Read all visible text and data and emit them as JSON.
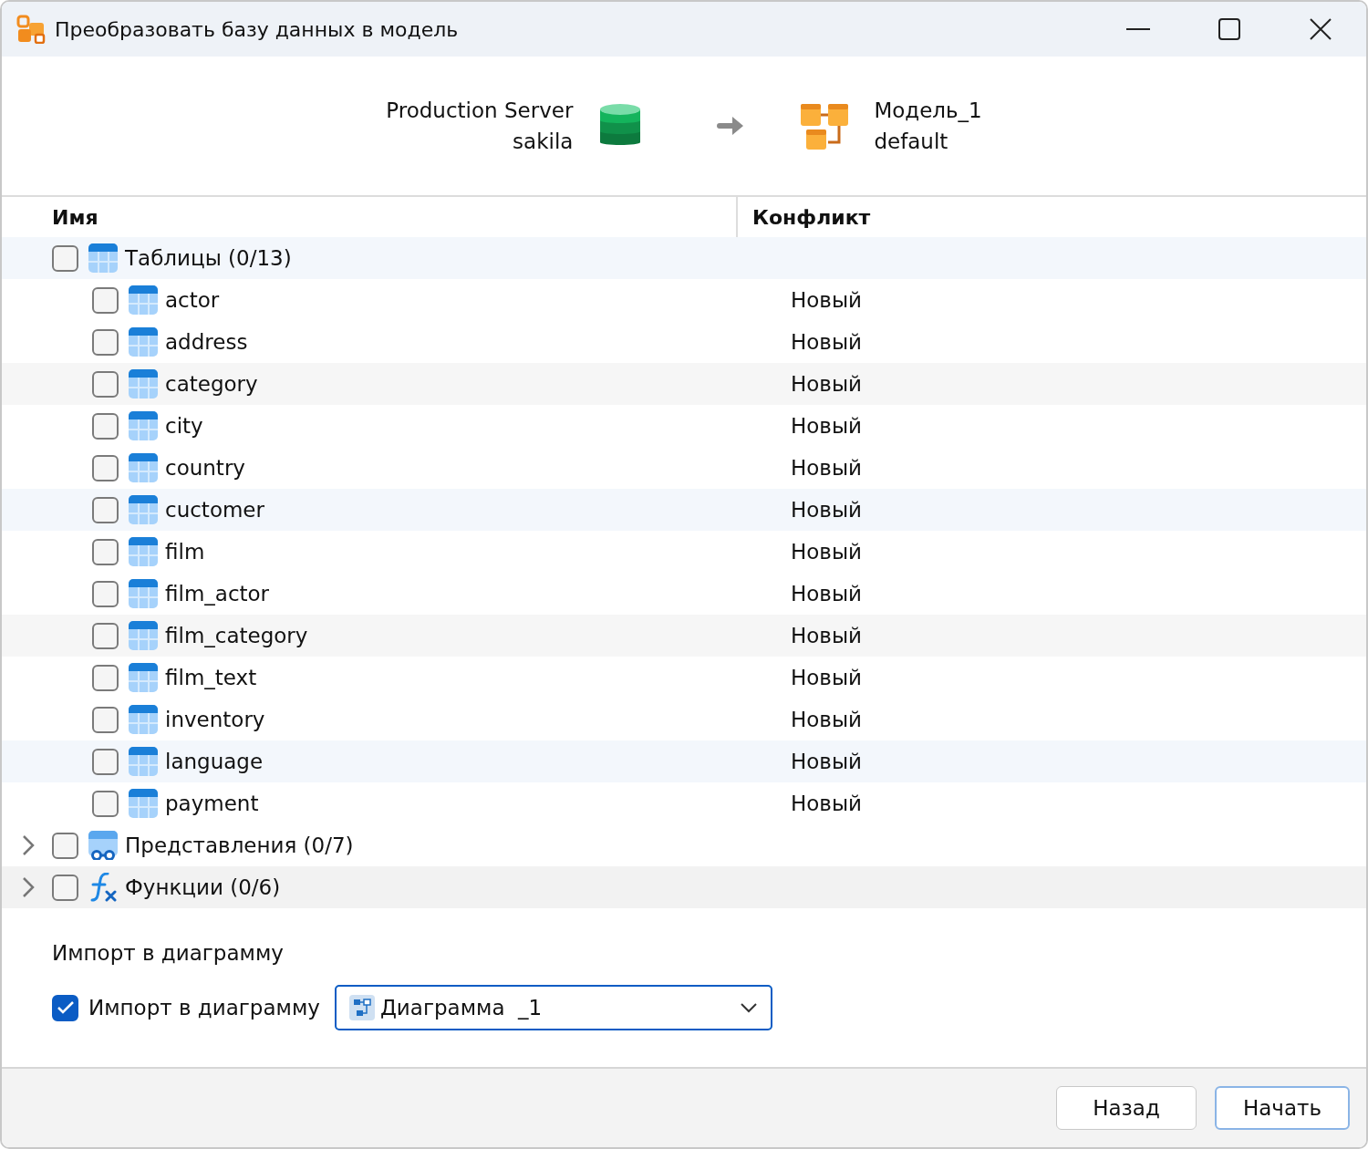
{
  "window": {
    "title": "Преобразовать базу данных в модель"
  },
  "source": {
    "name": "Production Server",
    "database": "sakila"
  },
  "target": {
    "name": "Модель_1",
    "schema": "default"
  },
  "table": {
    "columns": [
      "Имя",
      "Конфликт"
    ],
    "groups": [
      {
        "kind": "tables",
        "label": "Таблицы (0/13)",
        "checked": false,
        "expanded": true,
        "highlighted": true,
        "color": "#f3f7fc",
        "children": [
          {
            "label": "actor",
            "checked": false,
            "conflict": "Новый",
            "highlighted": false
          },
          {
            "label": "address",
            "checked": false,
            "conflict": "Новый",
            "highlighted": false
          },
          {
            "label": "category",
            "checked": false,
            "conflict": "Новый",
            "highlighted": true,
            "color": "#f6f6f6"
          },
          {
            "label": "city",
            "checked": false,
            "conflict": "Новый",
            "highlighted": false
          },
          {
            "label": "country",
            "checked": false,
            "conflict": "Новый",
            "highlighted": false
          },
          {
            "label": "cuctomer",
            "checked": false,
            "conflict": "Новый",
            "highlighted": true,
            "color": "#f3f7fc"
          },
          {
            "label": "film",
            "checked": false,
            "conflict": "Новый",
            "highlighted": false
          },
          {
            "label": "film_actor",
            "checked": false,
            "conflict": "Новый",
            "highlighted": false
          },
          {
            "label": "film_category",
            "checked": false,
            "conflict": "Новый",
            "highlighted": true,
            "color": "#f6f6f6"
          },
          {
            "label": "film_text",
            "checked": false,
            "conflict": "Новый",
            "highlighted": false
          },
          {
            "label": "inventory",
            "checked": false,
            "conflict": "Новый",
            "highlighted": false
          },
          {
            "label": "language",
            "checked": false,
            "conflict": "Новый",
            "highlighted": true,
            "color": "#f3f7fc"
          },
          {
            "label": "payment",
            "checked": false,
            "conflict": "Новый",
            "highlighted": false
          }
        ]
      },
      {
        "kind": "views",
        "label": "Представления (0/7)",
        "checked": false,
        "expanded": false,
        "highlighted": false
      },
      {
        "kind": "functions",
        "label": "Функции (0/6)",
        "checked": false,
        "expanded": false,
        "highlighted": true,
        "color": "#f2f2f2"
      }
    ]
  },
  "import": {
    "heading": "Импорт в диаграмму",
    "label": "Импорт в диаграмму",
    "checked": true,
    "diagram": "Диаграмма  _1"
  },
  "buttons": [
    {
      "label": "Назад",
      "primary": false
    },
    {
      "label": "Начать",
      "primary": true
    }
  ]
}
